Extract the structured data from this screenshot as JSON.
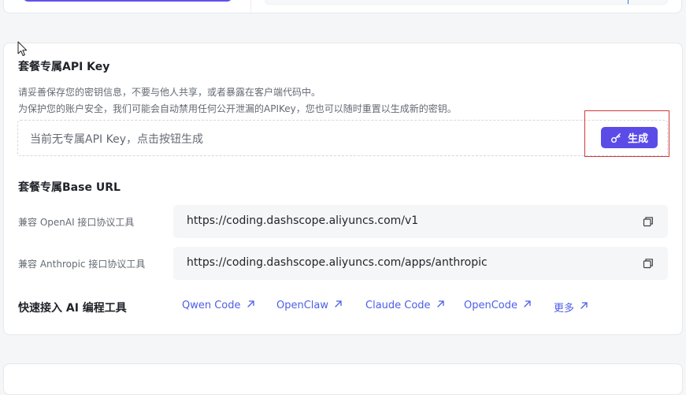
{
  "api_key_section": {
    "title": "套餐专属API Key",
    "hint_line1": "请妥善保存您的密钥信息，不要与他人共享，或者暴露在客户端代码中。",
    "hint_line2": "为保护您的账户安全，我们可能会自动禁用任何公开泄漏的APIKey，您也可以随时重置以生成新的密钥。",
    "placeholder": "当前无专属API Key，点击按钮生成",
    "generate_label": "生成"
  },
  "base_url_section": {
    "title": "套餐专属Base URL",
    "rows": [
      {
        "label": "兼容 OpenAI 接口协议工具",
        "url": "https://coding.dashscope.aliyuncs.com/v1"
      },
      {
        "label": "兼容 Anthropic 接口协议工具",
        "url": "https://coding.dashscope.aliyuncs.com/apps/anthropic"
      }
    ]
  },
  "quick_access": {
    "title": "快速接入 AI 编程工具",
    "links": [
      "Qwen Code",
      "OpenClaw",
      "Claude Code",
      "OpenCode",
      "更多"
    ]
  },
  "colors": {
    "accent": "#5b4ce8",
    "link": "#4c5ee8",
    "highlight": "#d2383c"
  }
}
